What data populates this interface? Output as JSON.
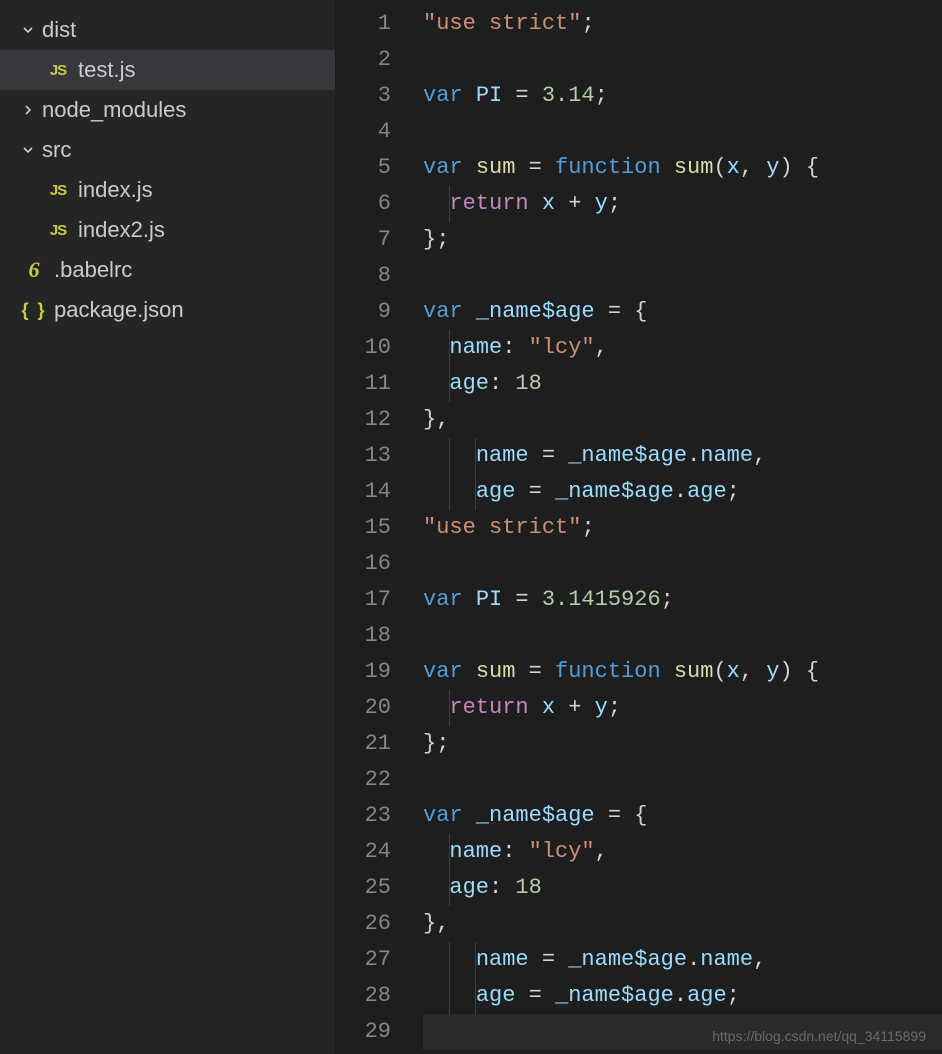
{
  "explorer": {
    "items": [
      {
        "name": "dist",
        "type": "folder",
        "expanded": true,
        "indent": 0
      },
      {
        "name": "test.js",
        "type": "file",
        "iconKind": "js",
        "indent": 1,
        "selected": true
      },
      {
        "name": "node_modules",
        "type": "folder",
        "expanded": false,
        "indent": 0
      },
      {
        "name": "src",
        "type": "folder",
        "expanded": true,
        "indent": 0
      },
      {
        "name": "index.js",
        "type": "file",
        "iconKind": "js",
        "indent": 1
      },
      {
        "name": "index2.js",
        "type": "file",
        "iconKind": "js",
        "indent": 1
      },
      {
        "name": ".babelrc",
        "type": "file",
        "iconKind": "babel",
        "indent": 0
      },
      {
        "name": "package.json",
        "type": "file",
        "iconKind": "json",
        "indent": 0
      }
    ]
  },
  "icons": {
    "js": "JS",
    "babel": "6",
    "json": "{ }"
  },
  "editor": {
    "lineCount": 29,
    "lines": [
      [
        [
          "str",
          "\"use strict\""
        ],
        [
          "pun",
          ";"
        ]
      ],
      [],
      [
        [
          "kw",
          "var "
        ],
        [
          "var",
          "PI"
        ],
        [
          "pun",
          " = "
        ],
        [
          "num",
          "3.14"
        ],
        [
          "pun",
          ";"
        ]
      ],
      [],
      [
        [
          "kw",
          "var "
        ],
        [
          "fn",
          "sum"
        ],
        [
          "pun",
          " = "
        ],
        [
          "kw",
          "function "
        ],
        [
          "fn",
          "sum"
        ],
        [
          "pun",
          "("
        ],
        [
          "var",
          "x"
        ],
        [
          "pun",
          ", "
        ],
        [
          "var",
          "y"
        ],
        [
          "pun",
          ") {"
        ]
      ],
      [
        [
          "pun",
          "  "
        ],
        [
          "ret",
          "return"
        ],
        [
          "pun",
          " "
        ],
        [
          "var",
          "x"
        ],
        [
          "pun",
          " + "
        ],
        [
          "var",
          "y"
        ],
        [
          "pun",
          ";"
        ]
      ],
      [
        [
          "pun",
          "};"
        ]
      ],
      [],
      [
        [
          "kw",
          "var "
        ],
        [
          "var",
          "_name$age"
        ],
        [
          "pun",
          " = {"
        ]
      ],
      [
        [
          "pun",
          "  "
        ],
        [
          "var",
          "name"
        ],
        [
          "pun",
          ": "
        ],
        [
          "str",
          "\"lcy\""
        ],
        [
          "pun",
          ","
        ]
      ],
      [
        [
          "pun",
          "  "
        ],
        [
          "var",
          "age"
        ],
        [
          "pun",
          ": "
        ],
        [
          "num",
          "18"
        ]
      ],
      [
        [
          "pun",
          "},"
        ]
      ],
      [
        [
          "pun",
          "    "
        ],
        [
          "var",
          "name"
        ],
        [
          "pun",
          " = "
        ],
        [
          "var",
          "_name$age"
        ],
        [
          "pun",
          "."
        ],
        [
          "var",
          "name"
        ],
        [
          "pun",
          ","
        ]
      ],
      [
        [
          "pun",
          "    "
        ],
        [
          "var",
          "age"
        ],
        [
          "pun",
          " = "
        ],
        [
          "var",
          "_name$age"
        ],
        [
          "pun",
          "."
        ],
        [
          "var",
          "age"
        ],
        [
          "pun",
          ";"
        ]
      ],
      [
        [
          "str",
          "\"use strict\""
        ],
        [
          "pun",
          ";"
        ]
      ],
      [],
      [
        [
          "kw",
          "var "
        ],
        [
          "var",
          "PI"
        ],
        [
          "pun",
          " = "
        ],
        [
          "num",
          "3.1415926"
        ],
        [
          "pun",
          ";"
        ]
      ],
      [],
      [
        [
          "kw",
          "var "
        ],
        [
          "fn",
          "sum"
        ],
        [
          "pun",
          " = "
        ],
        [
          "kw",
          "function "
        ],
        [
          "fn",
          "sum"
        ],
        [
          "pun",
          "("
        ],
        [
          "var",
          "x"
        ],
        [
          "pun",
          ", "
        ],
        [
          "var",
          "y"
        ],
        [
          "pun",
          ") {"
        ]
      ],
      [
        [
          "pun",
          "  "
        ],
        [
          "ret",
          "return"
        ],
        [
          "pun",
          " "
        ],
        [
          "var",
          "x"
        ],
        [
          "pun",
          " + "
        ],
        [
          "var",
          "y"
        ],
        [
          "pun",
          ";"
        ]
      ],
      [
        [
          "pun",
          "};"
        ]
      ],
      [],
      [
        [
          "kw",
          "var "
        ],
        [
          "var",
          "_name$age"
        ],
        [
          "pun",
          " = {"
        ]
      ],
      [
        [
          "pun",
          "  "
        ],
        [
          "var",
          "name"
        ],
        [
          "pun",
          ": "
        ],
        [
          "str",
          "\"lcy\""
        ],
        [
          "pun",
          ","
        ]
      ],
      [
        [
          "pun",
          "  "
        ],
        [
          "var",
          "age"
        ],
        [
          "pun",
          ": "
        ],
        [
          "num",
          "18"
        ]
      ],
      [
        [
          "pun",
          "},"
        ]
      ],
      [
        [
          "pun",
          "    "
        ],
        [
          "var",
          "name"
        ],
        [
          "pun",
          " = "
        ],
        [
          "var",
          "_name$age"
        ],
        [
          "pun",
          "."
        ],
        [
          "var",
          "name"
        ],
        [
          "pun",
          ","
        ]
      ],
      [
        [
          "pun",
          "    "
        ],
        [
          "var",
          "age"
        ],
        [
          "pun",
          " = "
        ],
        [
          "var",
          "_name$age"
        ],
        [
          "pun",
          "."
        ],
        [
          "var",
          "age"
        ],
        [
          "pun",
          ";"
        ]
      ],
      []
    ],
    "guides": {
      "6": [
        1
      ],
      "10": [
        1
      ],
      "11": [
        1
      ],
      "13": [
        1,
        2
      ],
      "14": [
        1,
        2
      ],
      "20": [
        1
      ],
      "24": [
        1
      ],
      "25": [
        1
      ],
      "27": [
        1,
        2
      ],
      "28": [
        1,
        2
      ]
    }
  },
  "watermark": "https://blog.csdn.net/qq_34115899"
}
